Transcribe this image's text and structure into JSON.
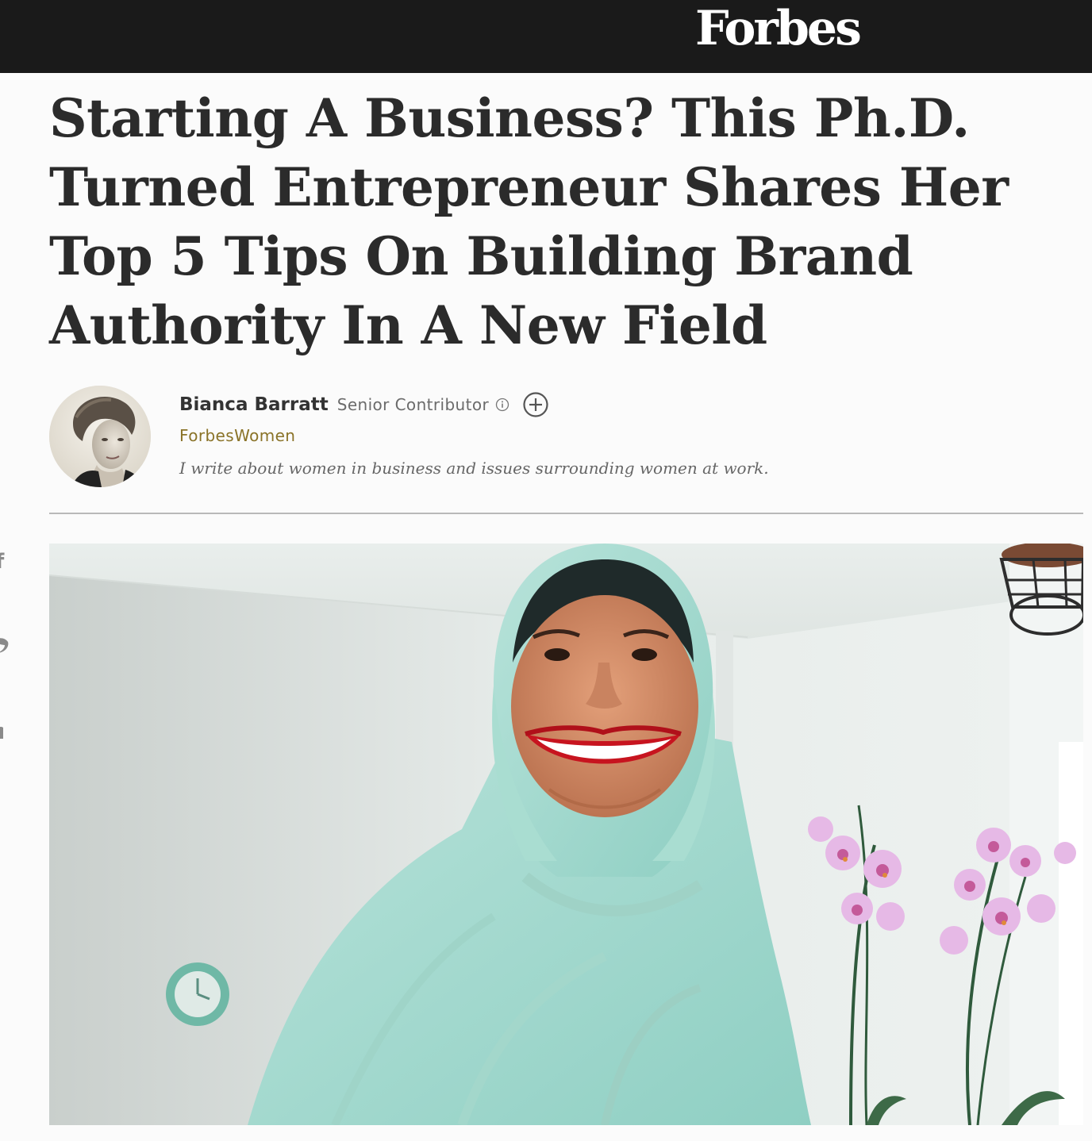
{
  "header": {
    "logo_text": "Forbes",
    "background_color": "#1a1a1a"
  },
  "article": {
    "headline": "Starting A Business? This Ph.D. Turned Entrepreneur Shares Her Top 5 Tips On Building Brand Authority In A New Field",
    "author": {
      "name": "Bianca Barratt",
      "role": "Senior Contributor",
      "channel": "ForbesWomen",
      "bio": "I write about women in business and issues surrounding women at work.",
      "info_icon": "info-circle-icon",
      "follow_icon": "plus-circle-icon"
    },
    "hero_image": {
      "description_icon": "hero-photo"
    }
  },
  "share_rail": {
    "items": [
      {
        "icon": "facebook-icon",
        "glyph": "f"
      },
      {
        "icon": "twitter-icon",
        "glyph": "🐦"
      },
      {
        "icon": "linkedin-icon",
        "glyph": "in"
      }
    ]
  },
  "colors": {
    "channel": "#8a7328",
    "headline": "#2b2b2b",
    "divider": "#b9b9b9"
  }
}
